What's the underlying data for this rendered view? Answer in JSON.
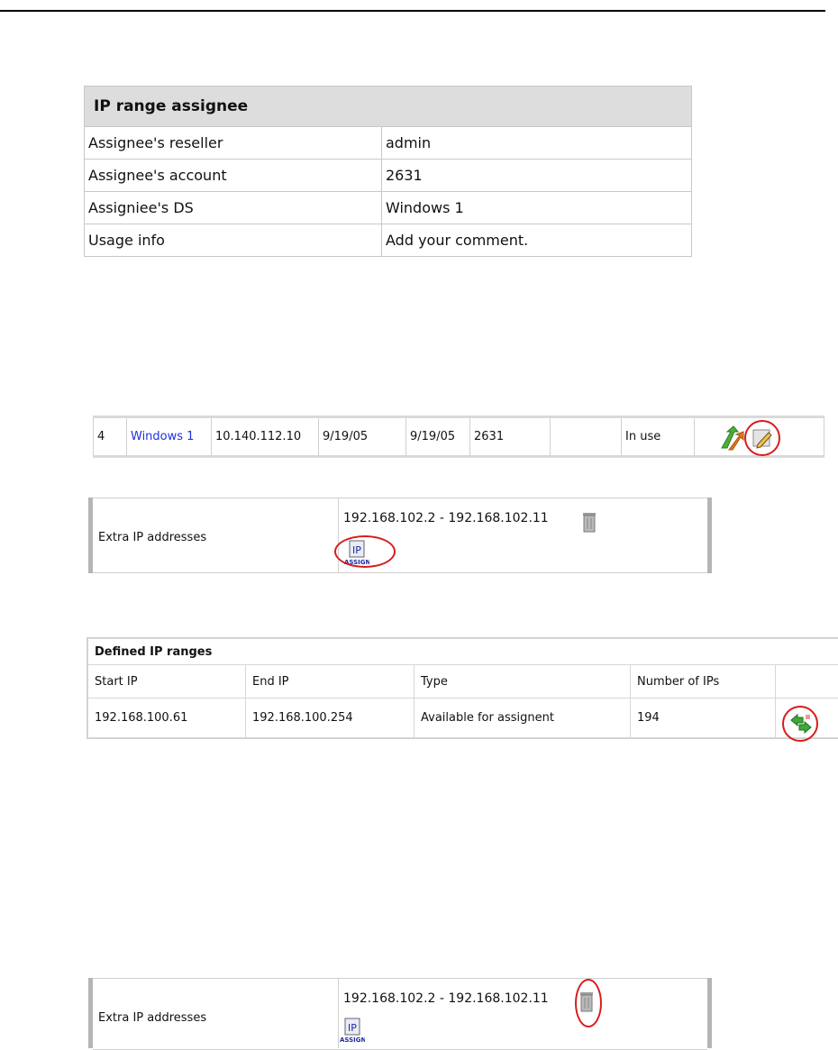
{
  "assignee": {
    "title": "IP range assignee",
    "rows": [
      {
        "label": "Assignee's reseller",
        "value": "admin"
      },
      {
        "label": "Assignee's account",
        "value": "2631"
      },
      {
        "label": "Assigniee's DS",
        "value": "Windows 1"
      },
      {
        "label": "Usage info",
        "value": "Add your comment."
      }
    ]
  },
  "server_row": {
    "id": "4",
    "name": "Windows 1",
    "ip": "10.140.112.10",
    "date1": "9/19/05",
    "date2": "9/19/05",
    "account": "2631",
    "blank": "",
    "status": "In use",
    "icons": [
      "swap-arrows-icon",
      "edit-icon"
    ]
  },
  "extra_ip_1": {
    "label": "Extra IP addresses",
    "range": "192.168.102.2 - 192.168.102.11",
    "icons": [
      "trash-icon",
      "ip-assign-icon"
    ]
  },
  "ranges": {
    "title": "Defined IP ranges",
    "columns": [
      "Start IP",
      "End IP",
      "Type",
      "Number of IPs"
    ],
    "rows": [
      {
        "start": "192.168.100.61",
        "end": "192.168.100.254",
        "type": "Available for assignent",
        "count": "194",
        "icon": "reassign-arrows-icon"
      }
    ]
  },
  "extra_ip_2": {
    "label": "Extra IP addresses",
    "range": "192.168.102.2 - 192.168.102.11",
    "icons": [
      "trash-icon",
      "ip-assign-icon"
    ]
  },
  "colors": {
    "highlight": "#d81c1c",
    "link": "#1f2fe0"
  }
}
